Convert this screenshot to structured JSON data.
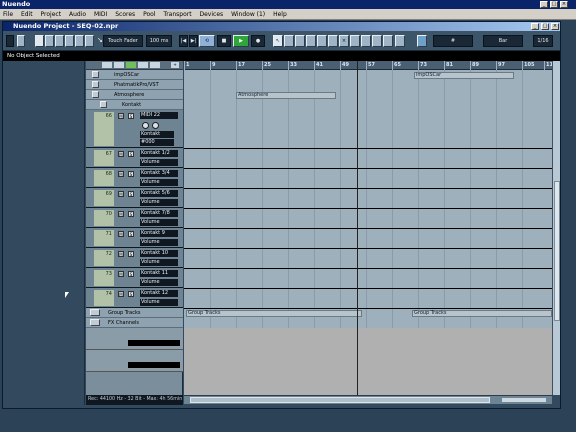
{
  "app": {
    "title": "Nuendo"
  },
  "menu": [
    "File",
    "Edit",
    "Project",
    "Audio",
    "MIDI",
    "Scores",
    "Pool",
    "Transport",
    "Devices",
    "Window (1)",
    "Help"
  ],
  "project": {
    "title": "Nuendo Project - SEQ-02.npr"
  },
  "toolbar": {
    "automation_mode": "Touch Fader",
    "zoom": "100 ms",
    "grid_type": "Bar",
    "quantize": "1/16"
  },
  "info_line": "No Object Selected",
  "ruler": [
    "1",
    "9",
    "17",
    "25",
    "33",
    "41",
    "49",
    "57",
    "65",
    "73",
    "81",
    "89",
    "97",
    "105",
    "113"
  ],
  "folders": {
    "top": [
      "impOSCar",
      "PhatmatikPro/VST",
      "Atmosphere",
      "Kontakt"
    ],
    "group": "Group Tracks",
    "fx": "FX Channels"
  },
  "tracks": [
    {
      "num": "66",
      "name": "MIDI 22",
      "sub": "Kontakt"
    },
    {
      "num": "67",
      "name": "Kontakt 1/2",
      "sub": "Volume"
    },
    {
      "num": "68",
      "name": "Kontakt 3/4",
      "sub": "Volume"
    },
    {
      "num": "69",
      "name": "Kontakt 5/6",
      "sub": "Volume"
    },
    {
      "num": "70",
      "name": "Kontakt 7/8",
      "sub": "Volume"
    },
    {
      "num": "71",
      "name": "Kontakt 9",
      "sub": "Volume"
    },
    {
      "num": "72",
      "name": "Kontakt 10",
      "sub": "Volume"
    },
    {
      "num": "73",
      "name": "Kontakt 11",
      "sub": "Volume"
    },
    {
      "num": "74",
      "name": "Kontakt 12",
      "sub": "Volume"
    }
  ],
  "track66_extra": "#000",
  "parts": {
    "p1": "impOSCar",
    "p2": "Atmosphere",
    "p3": "Group Tracks",
    "p4": "Group Tracks"
  },
  "status": "Rec: 44100 Hz - 32 Bit - Max: 4h 56min"
}
